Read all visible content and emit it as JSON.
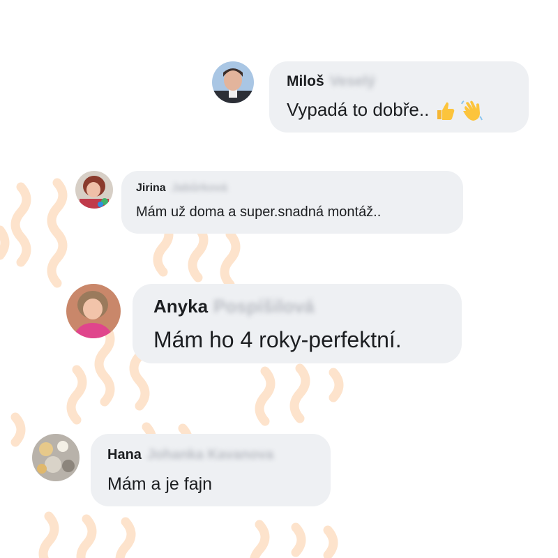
{
  "comments": [
    {
      "first_name": "Miloš",
      "surname_blurred": "Veselý",
      "text": "Vypadá to dobře..",
      "emojis": [
        "thumbs-up-emoji",
        "waving-hand-emoji"
      ]
    },
    {
      "first_name": "Jirina",
      "surname_blurred": "Jabůrková",
      "text": "Mám už doma a super.snadná montáž.."
    },
    {
      "first_name": "Anyka",
      "surname_blurred": "Pospíšilová",
      "text": "Mám ho 4 roky-perfektní."
    },
    {
      "first_name": "Hana",
      "surname_blurred": "Johanka Kavanova",
      "text": "Mám a je fajn"
    }
  ],
  "colors": {
    "bubble_background": "#eef0f3",
    "text": "#1c1e21",
    "background_wave": "#fde3cc"
  }
}
